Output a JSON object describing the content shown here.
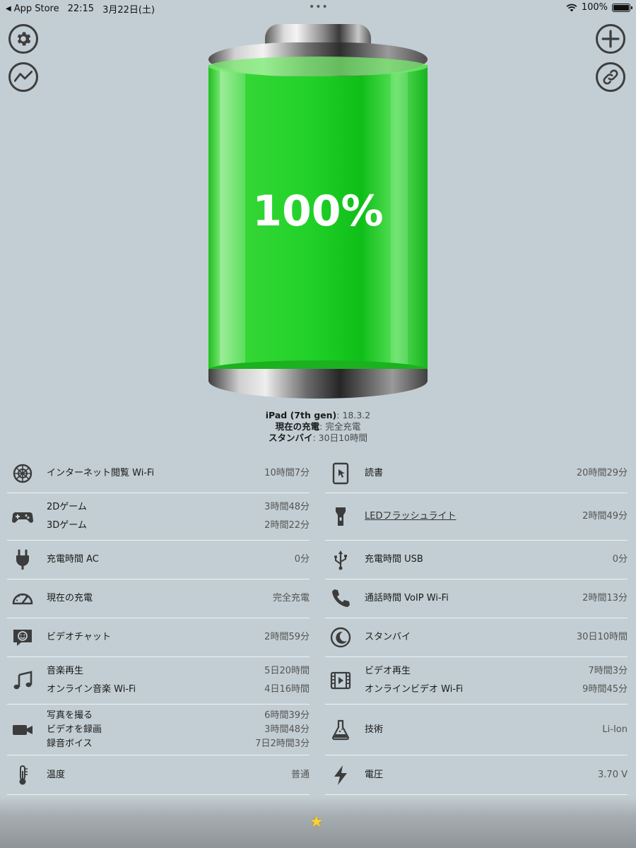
{
  "statusbar": {
    "back_app": "App Store",
    "time": "22:15",
    "date": "3月22日(土)",
    "battery_pct": "100%",
    "dots": "•••"
  },
  "battery": {
    "percent_text": "100%",
    "level_fraction": 1.0,
    "fill_color": "#22d22a"
  },
  "device": {
    "model_label": "iPad (7th gen)",
    "os_version": ": 18.3.2",
    "charge_label": "現在の充電",
    "charge_value": ": 完全充電",
    "standby_label": "スタンバイ",
    "standby_value": ": 30日10時間"
  },
  "left_rows": [
    {
      "icon": "globe-icon",
      "lines": [
        {
          "name": "インターネット閲覧 Wi-Fi",
          "value": "10時間7分"
        }
      ]
    },
    {
      "icon": "gamepad-icon",
      "lines": [
        {
          "name": "2Dゲーム",
          "value": "3時間48分"
        },
        {
          "name": "3Dゲーム",
          "value": "2時間22分"
        }
      ]
    },
    {
      "icon": "plug-icon",
      "lines": [
        {
          "name": "充電時間 AC",
          "value": "0分"
        }
      ]
    },
    {
      "icon": "gauge-icon",
      "lines": [
        {
          "name": "現在の充電",
          "value": "完全充電"
        }
      ]
    },
    {
      "icon": "video-chat-icon",
      "lines": [
        {
          "name": "ビデオチャット",
          "value": "2時間59分"
        }
      ]
    },
    {
      "icon": "music-note-icon",
      "lines": [
        {
          "name": "音楽再生",
          "value": "5日20時間"
        },
        {
          "name": "オンライン音楽 Wi-Fi",
          "value": "4日16時間"
        }
      ]
    },
    {
      "icon": "camera-icon",
      "lines": [
        {
          "name": "写真を撮る",
          "value": "6時間39分"
        },
        {
          "name": "ビデオを録画",
          "value": "3時間48分"
        },
        {
          "name": "録音ボイス",
          "value": "7日2時間3分"
        }
      ]
    },
    {
      "icon": "thermometer-icon",
      "lines": [
        {
          "name": "温度",
          "value": "普通"
        }
      ]
    }
  ],
  "right_rows": [
    {
      "icon": "tablet-icon",
      "lines": [
        {
          "name": "読書",
          "value": "20時間29分"
        }
      ]
    },
    {
      "icon": "flashlight-icon",
      "lines": [
        {
          "name": "LEDフラッシュライト",
          "value": "2時間49分"
        }
      ]
    },
    {
      "icon": "usb-icon",
      "lines": [
        {
          "name": "充電時間 USB",
          "value": "0分"
        }
      ]
    },
    {
      "icon": "phone-icon",
      "lines": [
        {
          "name": "通話時間 VoIP Wi-Fi",
          "value": "2時間13分"
        }
      ]
    },
    {
      "icon": "moon-icon",
      "lines": [
        {
          "name": "スタンバイ",
          "value": "30日10時間"
        }
      ]
    },
    {
      "icon": "film-icon",
      "lines": [
        {
          "name": "ビデオ再生",
          "value": "7時間3分"
        },
        {
          "name": "オンラインビデオ Wi-Fi",
          "value": "9時間45分"
        }
      ]
    },
    {
      "icon": "flask-icon",
      "lines": [
        {
          "name": "技術",
          "value": "Li-Ion"
        }
      ]
    },
    {
      "icon": "bolt-icon",
      "lines": [
        {
          "name": "電圧",
          "value": "3.70 V"
        }
      ]
    }
  ],
  "bottom": {
    "star": "★"
  }
}
